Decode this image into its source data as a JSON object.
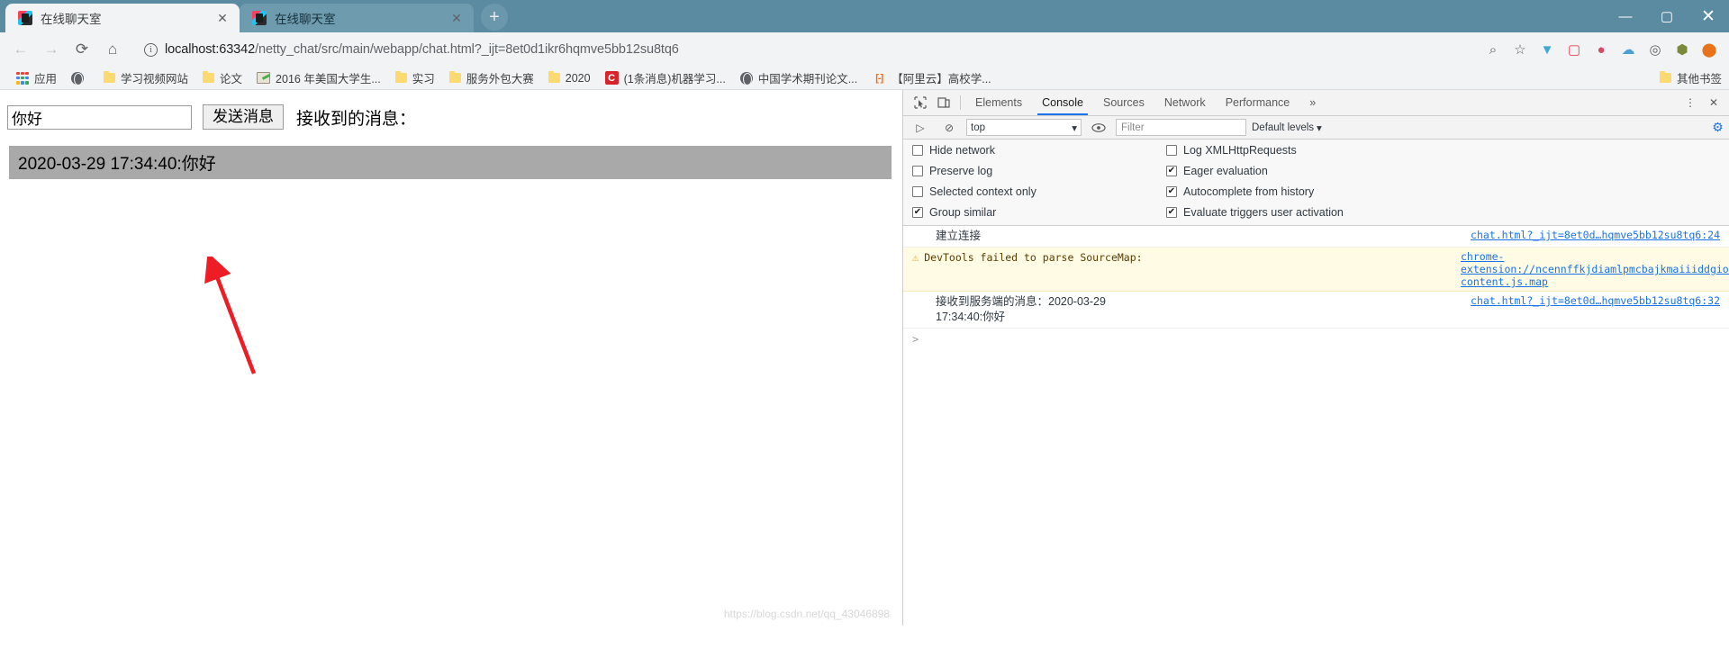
{
  "browser": {
    "tabs": [
      {
        "title": "在线聊天室",
        "active": true
      },
      {
        "title": "在线聊天室",
        "active": false
      }
    ],
    "new_tab_label": "+",
    "window_controls": {
      "minimize": "—",
      "maximize": "▢",
      "close": "✕"
    },
    "nav": {
      "back": "←",
      "forward": "→",
      "reload": "⟳",
      "home": "⌂"
    },
    "omnibox": {
      "info_icon": "ⓘ",
      "host": "localhost:63342",
      "path": "/netty_chat/src/main/webapp/chat.html?_ijt=8et0d1ikr6hqmve5bb12su8tq6",
      "full_url": "localhost:63342/netty_chat/src/main/webapp/chat.html?_ijt=8et0d1ikr6hqmve5bb12su8tq6"
    },
    "toolbar_icons": [
      "zoom-icon",
      "star-icon",
      "extension-icon",
      "pocket-icon",
      "circle-icon",
      "cloud-icon",
      "search-icon",
      "puzzle-icon",
      "update-icon"
    ],
    "bookmarks": [
      {
        "label": "应用",
        "icon": "apps-grid-icon"
      },
      {
        "label": "",
        "icon": "globe-icon"
      },
      {
        "label": "学习视频网站",
        "icon": "folder-icon"
      },
      {
        "label": "论文",
        "icon": "folder-icon"
      },
      {
        "label": "2016 年美国大学生...",
        "icon": "book-icon"
      },
      {
        "label": "实习",
        "icon": "folder-icon"
      },
      {
        "label": "服务外包大赛",
        "icon": "folder-icon"
      },
      {
        "label": "2020",
        "icon": "folder-icon"
      },
      {
        "label": "(1条消息)机器学习...",
        "icon": "csdn-icon"
      },
      {
        "label": "中国学术期刊论文...",
        "icon": "globe-icon"
      },
      {
        "label": "【阿里云】高校学...",
        "icon": "aliyun-icon"
      }
    ],
    "bookmarks_overflow": "其他书签"
  },
  "page": {
    "input_value": "你好",
    "input_placeholder": "",
    "send_button": "发送消息",
    "received_label": "接收到的消息：",
    "messages": [
      "2020-03-29 17:34:40:你好"
    ]
  },
  "devtools": {
    "tabs": [
      {
        "label": "Elements",
        "active": false
      },
      {
        "label": "Console",
        "active": true
      },
      {
        "label": "Sources",
        "active": false
      },
      {
        "label": "Network",
        "active": false
      },
      {
        "label": "Performance",
        "active": false
      }
    ],
    "more_tabs": "»",
    "menu_icon": "⋮",
    "close_icon": "✕",
    "inspect_icon": "cursor-select-icon",
    "device_icon": "device-toolbar-icon",
    "execute_icon": "▷",
    "clear_icon": "⊘",
    "context_selector": "top",
    "context_caret": "▾",
    "eye_icon": "👁",
    "filter_placeholder": "Filter",
    "levels_label": "Default levels",
    "levels_caret": "▾",
    "settings_icon": "gear-icon",
    "options": [
      {
        "label": "Hide network",
        "checked": false
      },
      {
        "label": "Log XMLHttpRequests",
        "checked": false
      },
      {
        "label": "Preserve log",
        "checked": false
      },
      {
        "label": "Eager evaluation",
        "checked": true
      },
      {
        "label": "Selected context only",
        "checked": false
      },
      {
        "label": "Autocomplete from history",
        "checked": true
      },
      {
        "label": "Group similar",
        "checked": true
      },
      {
        "label": "Evaluate triggers user activation",
        "checked": true
      }
    ],
    "messages": [
      {
        "type": "log",
        "text": "建立连接",
        "source": "chat.html?_ijt=8et0d…hqmve5bb12su8tq6:24"
      },
      {
        "type": "warning",
        "icon": "⚠",
        "text": "DevTools failed to parse SourceMap:",
        "source": "chrome-extension://ncennffkjdiamlpmcbajkmaiiiddgioo/js/xl-content.js.map"
      },
      {
        "type": "log",
        "text": "接收到服务端的消息：2020-03-29 17:34:40:你好",
        "source": "chat.html?_ijt=8et0d…hqmve5bb12su8tq6:32"
      }
    ],
    "prompt_symbol": ">"
  },
  "watermark": "https://blog.csdn.net/qq_43046898",
  "colors": {
    "tab_strip": "#5b8ba0",
    "accent": "#1a73e8",
    "message_row_bg": "#a9a9a9",
    "warning_bg": "#fffbe5",
    "arrow": "#ee1c25"
  }
}
